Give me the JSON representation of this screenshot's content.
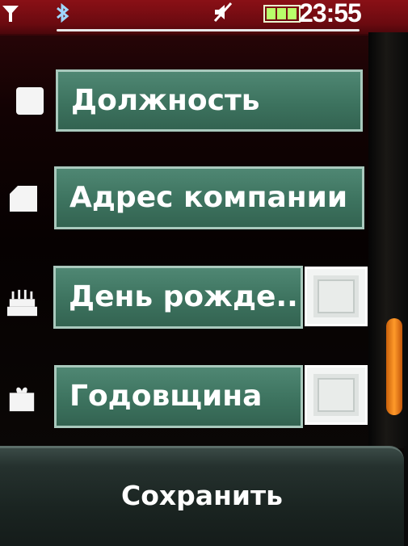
{
  "status_bar": {
    "time": "23:55",
    "icons": [
      "signal-icon",
      "bluetooth-icon",
      "mute-icon",
      "battery-icon"
    ]
  },
  "fields": [
    {
      "label": "Должность",
      "icon": "person-icon",
      "checkbox": false
    },
    {
      "label": "Адрес компании",
      "icon": "building-icon",
      "checkbox": false
    },
    {
      "label": "День рожде...",
      "icon": "cake-icon",
      "checkbox": true,
      "checked": false
    },
    {
      "label": "Годовщина",
      "icon": "gift-icon",
      "checkbox": true,
      "checked": false
    }
  ],
  "bottom_bar": {
    "save_label": "Сохранить"
  },
  "colors": {
    "field_green": "#3d735f",
    "status_red": "#6b0a10",
    "scroll_orange": "#ff9a2a"
  }
}
